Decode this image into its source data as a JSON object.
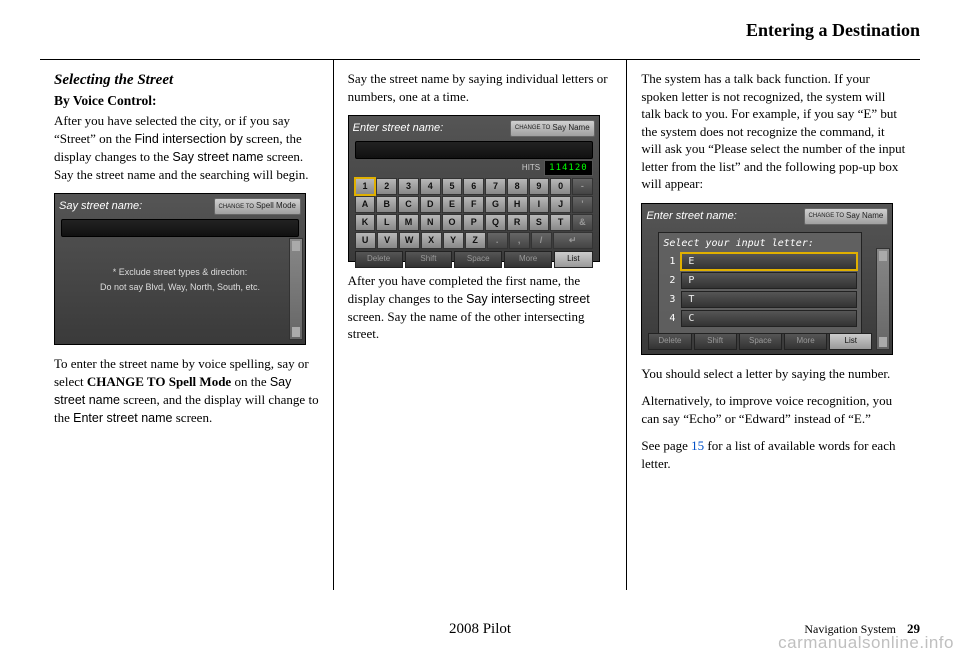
{
  "header": {
    "chapter_title": "Entering a Destination"
  },
  "col1": {
    "h_italic": "Selecting the Street",
    "h_bold": "By Voice Control:",
    "p1_a": "After you have selected the city, or if you say “Street” on the ",
    "p1_b": "Find intersection by",
    "p1_c": " screen, the display changes to the ",
    "p1_d": "Say street name",
    "p1_e": " screen. Say the street name and the searching will begin.",
    "shot1": {
      "title": "Say street name:",
      "mode_small": "CHANGE TO",
      "mode_label": "Spell Mode",
      "msg1": "* Exclude street types & direction:",
      "msg2": "Do not say Blvd, Way, North, South, etc."
    },
    "p2_a": "To enter the street name by voice spelling, say or select ",
    "p2_b": "CHANGE TO Spell Mode",
    "p2_c": " on the ",
    "p2_d": "Say street name",
    "p2_e": " screen, and the display will change to the ",
    "p2_f": "Enter street name",
    "p2_g": " screen."
  },
  "col2": {
    "p1": "Say the street name by saying individual letters or numbers, one at a time.",
    "shot2": {
      "title": "Enter street name:",
      "mode_small": "CHANGE TO",
      "mode_label": "Say Name",
      "hits_label": "HITS",
      "hits_value": "114120",
      "row1": [
        "1",
        "2",
        "3",
        "4",
        "5",
        "6",
        "7",
        "8",
        "9",
        "0",
        "-"
      ],
      "row2": [
        "A",
        "B",
        "C",
        "D",
        "E",
        "F",
        "G",
        "H",
        "I",
        "J",
        "'"
      ],
      "row3": [
        "K",
        "L",
        "M",
        "N",
        "O",
        "P",
        "Q",
        "R",
        "S",
        "T",
        "&"
      ],
      "row4": [
        "U",
        "V",
        "W",
        "X",
        "Y",
        "Z",
        ".",
        ",",
        "/",
        "↵"
      ],
      "fn": [
        "Delete",
        "Shift",
        "Space",
        "More",
        "List"
      ]
    },
    "p2_a": "After you have completed the first name, the display changes to the ",
    "p2_b": "Say intersecting street",
    "p2_c": " screen. Say the name of the other intersecting street."
  },
  "col3": {
    "p1": "The system has a talk back function. If your spoken letter is not recognized, the system will talk back to you. For example, if you say “E” but the system does not recognize the command, it will ask you “Please select the number of the input letter from the list” and the following pop-up box will appear:",
    "shot3": {
      "title": "Enter street name:",
      "mode_small": "CHANGE TO",
      "mode_label": "Say Name",
      "popup_title": "Select your input letter:",
      "options": [
        {
          "n": "1",
          "v": "E"
        },
        {
          "n": "2",
          "v": "P"
        },
        {
          "n": "3",
          "v": "T"
        },
        {
          "n": "4",
          "v": "C"
        }
      ],
      "fn": [
        "Delete",
        "Shift",
        "Space",
        "More",
        "List"
      ]
    },
    "p2": "You should select a letter by saying the number.",
    "p3": "Alternatively, to improve voice recognition, you can say “Echo” or “Edward” instead of “E.”",
    "p4_a": "See page ",
    "p4_link": "15",
    "p4_b": " for a list of available words for each letter."
  },
  "footer": {
    "center": "2008   Pilot",
    "right_label": "Navigation System",
    "page": "29"
  },
  "watermark": "carmanualsonline.info"
}
